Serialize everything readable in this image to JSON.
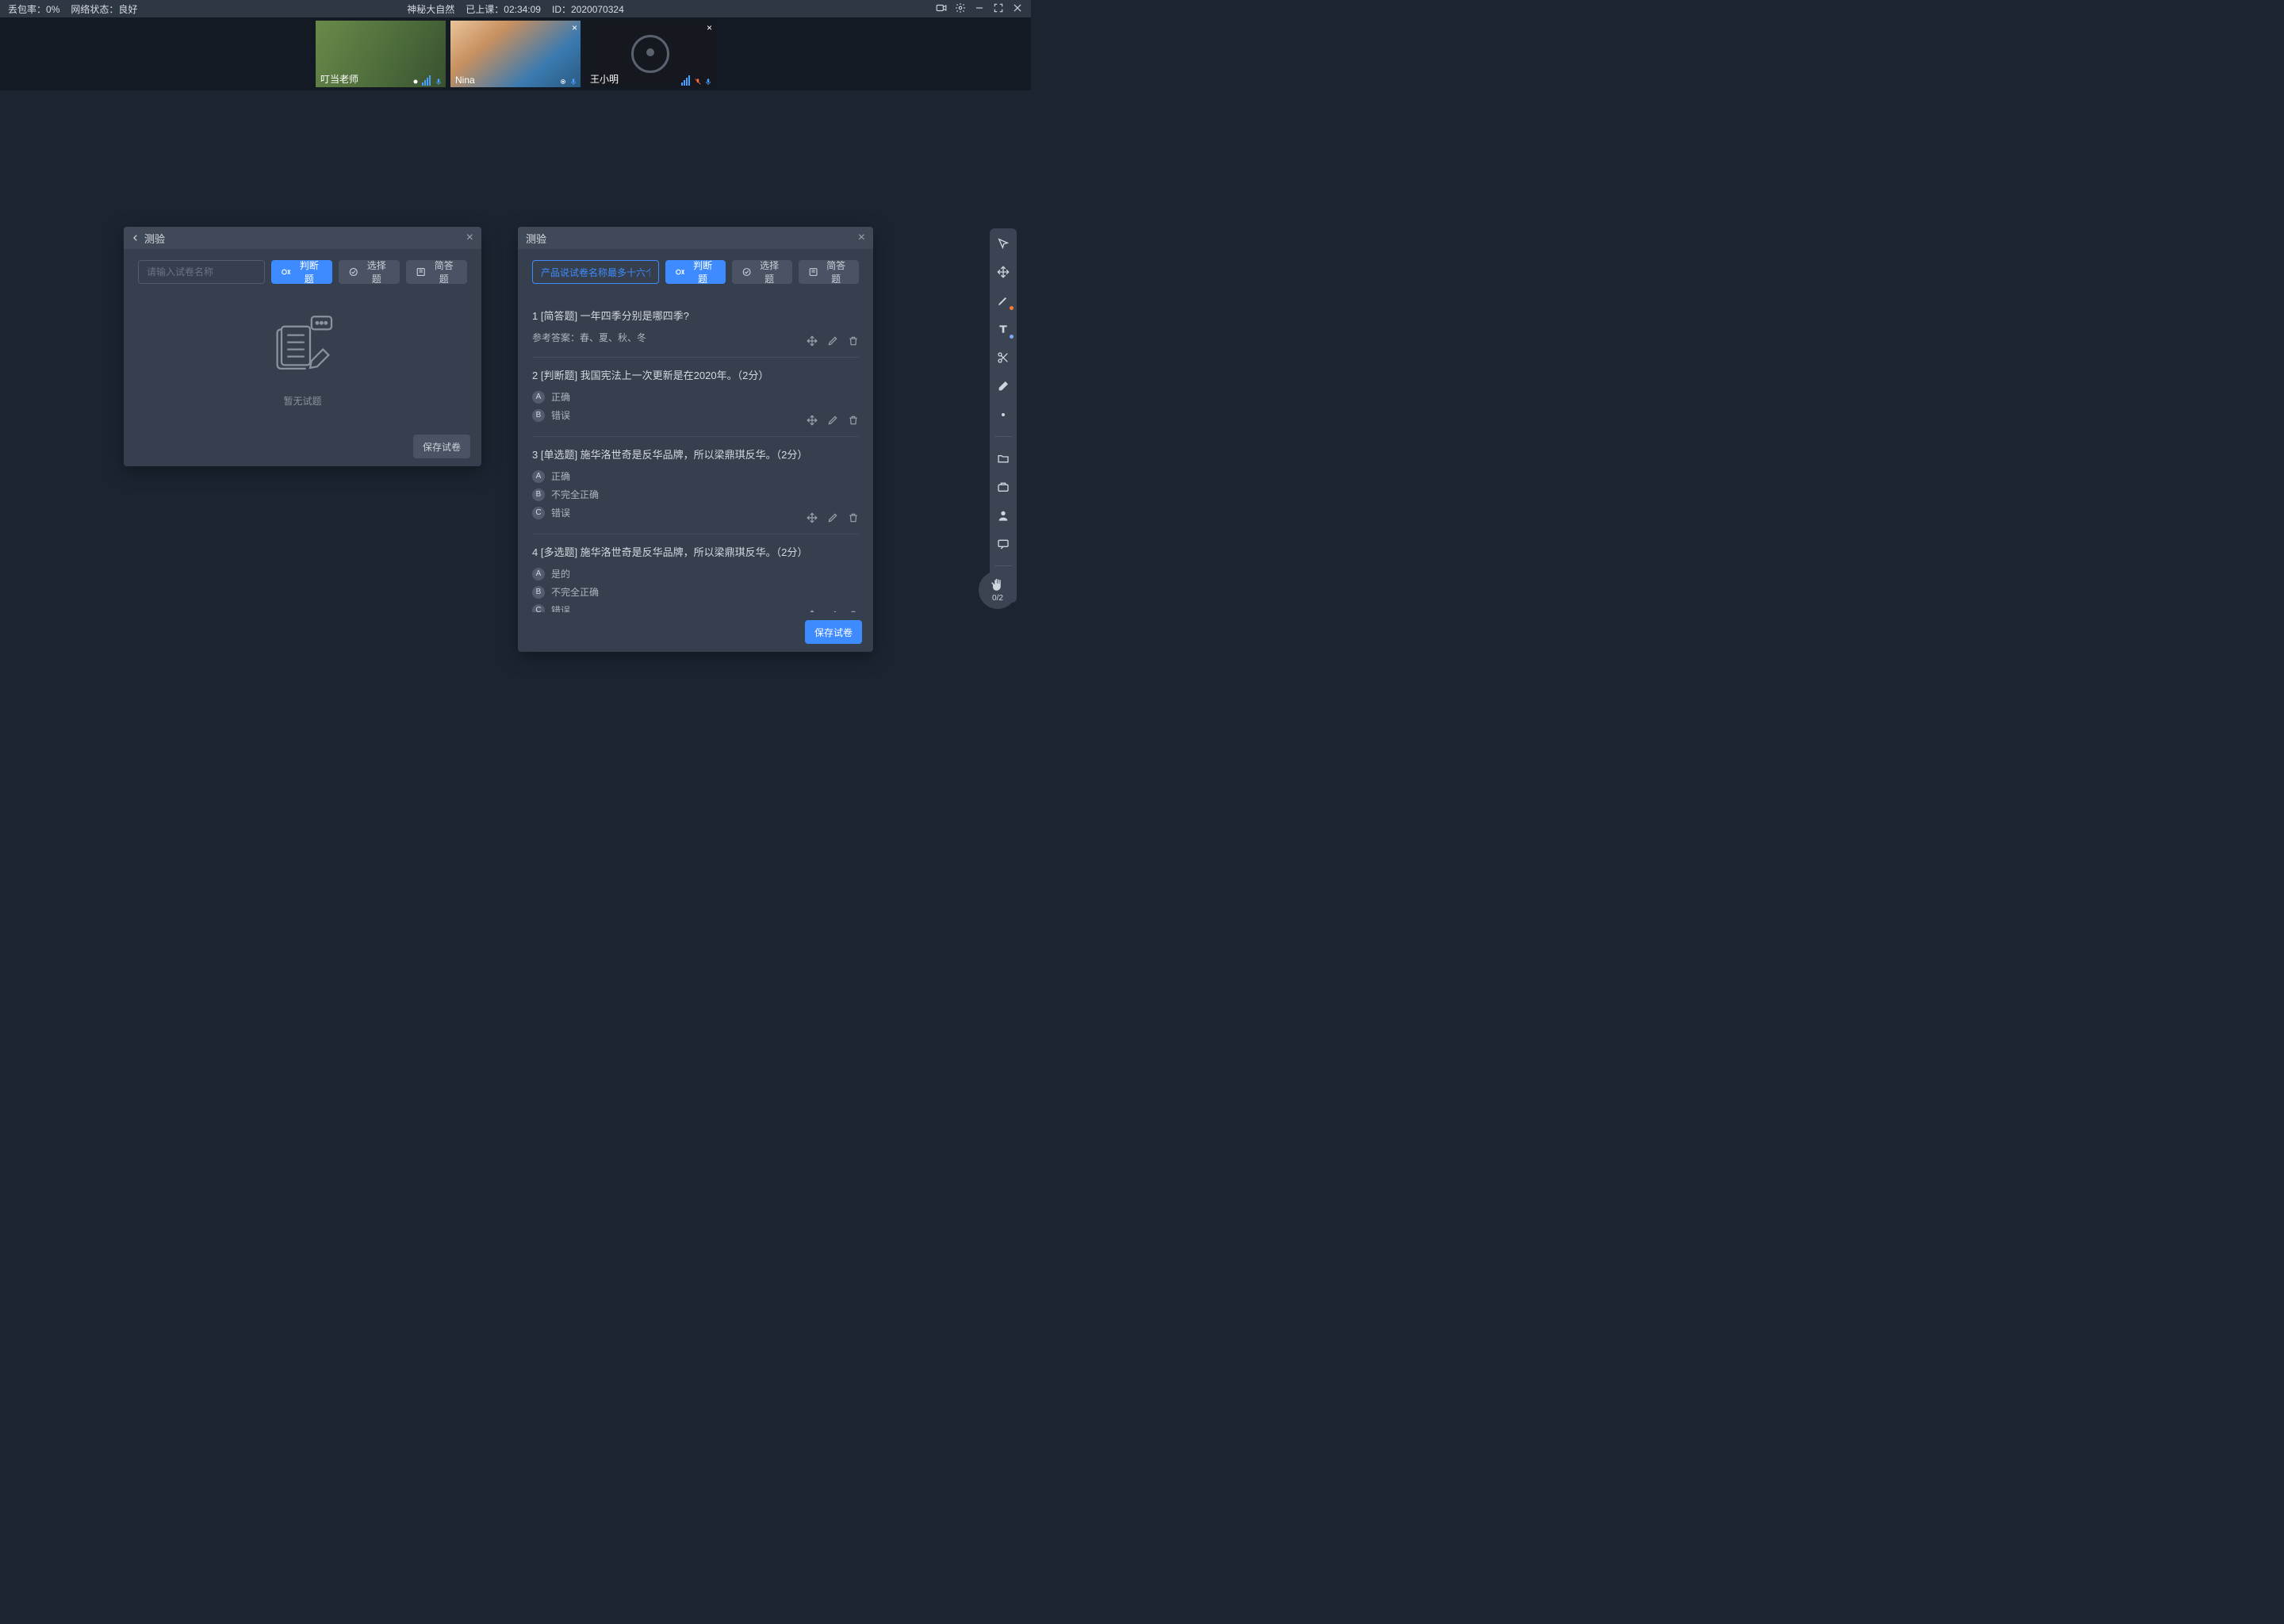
{
  "top": {
    "loss_label": "丢包率：",
    "loss_value": "0%",
    "net_label": "网络状态：",
    "net_value": "良好",
    "course_name": "神秘大自然",
    "elapsed_label": "已上课：",
    "elapsed_value": "02:34:09",
    "id_label": "ID：",
    "id_value": "2020070324"
  },
  "videos": [
    {
      "name": "叮当老师",
      "kind": "teacher",
      "closable": false
    },
    {
      "name": "Nina",
      "kind": "nina",
      "closable": true
    },
    {
      "name": "王小明",
      "kind": "dark",
      "closable": true
    }
  ],
  "panels": {
    "left": {
      "title": "测验",
      "input_placeholder": "请输入试卷名称",
      "btn_judge": "判断题",
      "btn_choice": "选择题",
      "btn_short": "简答题",
      "empty_text": "暂无试题",
      "save_btn": "保存试卷"
    },
    "right": {
      "title": "测验",
      "input_value": "产品说试卷名称最多十六个字",
      "btn_judge": "判断题",
      "btn_choice": "选择题",
      "btn_short": "简答题",
      "save_btn": "保存试卷",
      "answer_prefix": "参考答案：",
      "questions": [
        {
          "num": "1",
          "header": "1 [简答题] 一年四季分别是哪四季?",
          "reference": "春、夏、秋、冬",
          "options": []
        },
        {
          "num": "2",
          "header": "2 [判断题] 我国宪法上一次更新是在2020年。（2分）",
          "options": [
            {
              "letter": "A",
              "text": "正确"
            },
            {
              "letter": "B",
              "text": "错误"
            }
          ]
        },
        {
          "num": "3",
          "header": "3 [单选题] 施华洛世奇是反华品牌，所以梁鼎琪反华。（2分）",
          "options": [
            {
              "letter": "A",
              "text": "正确"
            },
            {
              "letter": "B",
              "text": "不完全正确"
            },
            {
              "letter": "C",
              "text": "错误"
            }
          ]
        },
        {
          "num": "4",
          "header": "4 [多选题] 施华洛世奇是反华品牌，所以梁鼎琪反华。（2分）",
          "options": [
            {
              "letter": "A",
              "text": "是的"
            },
            {
              "letter": "B",
              "text": "不完全正确"
            },
            {
              "letter": "C",
              "text": "错误"
            }
          ]
        }
      ]
    }
  },
  "hand_counter": "0/2"
}
